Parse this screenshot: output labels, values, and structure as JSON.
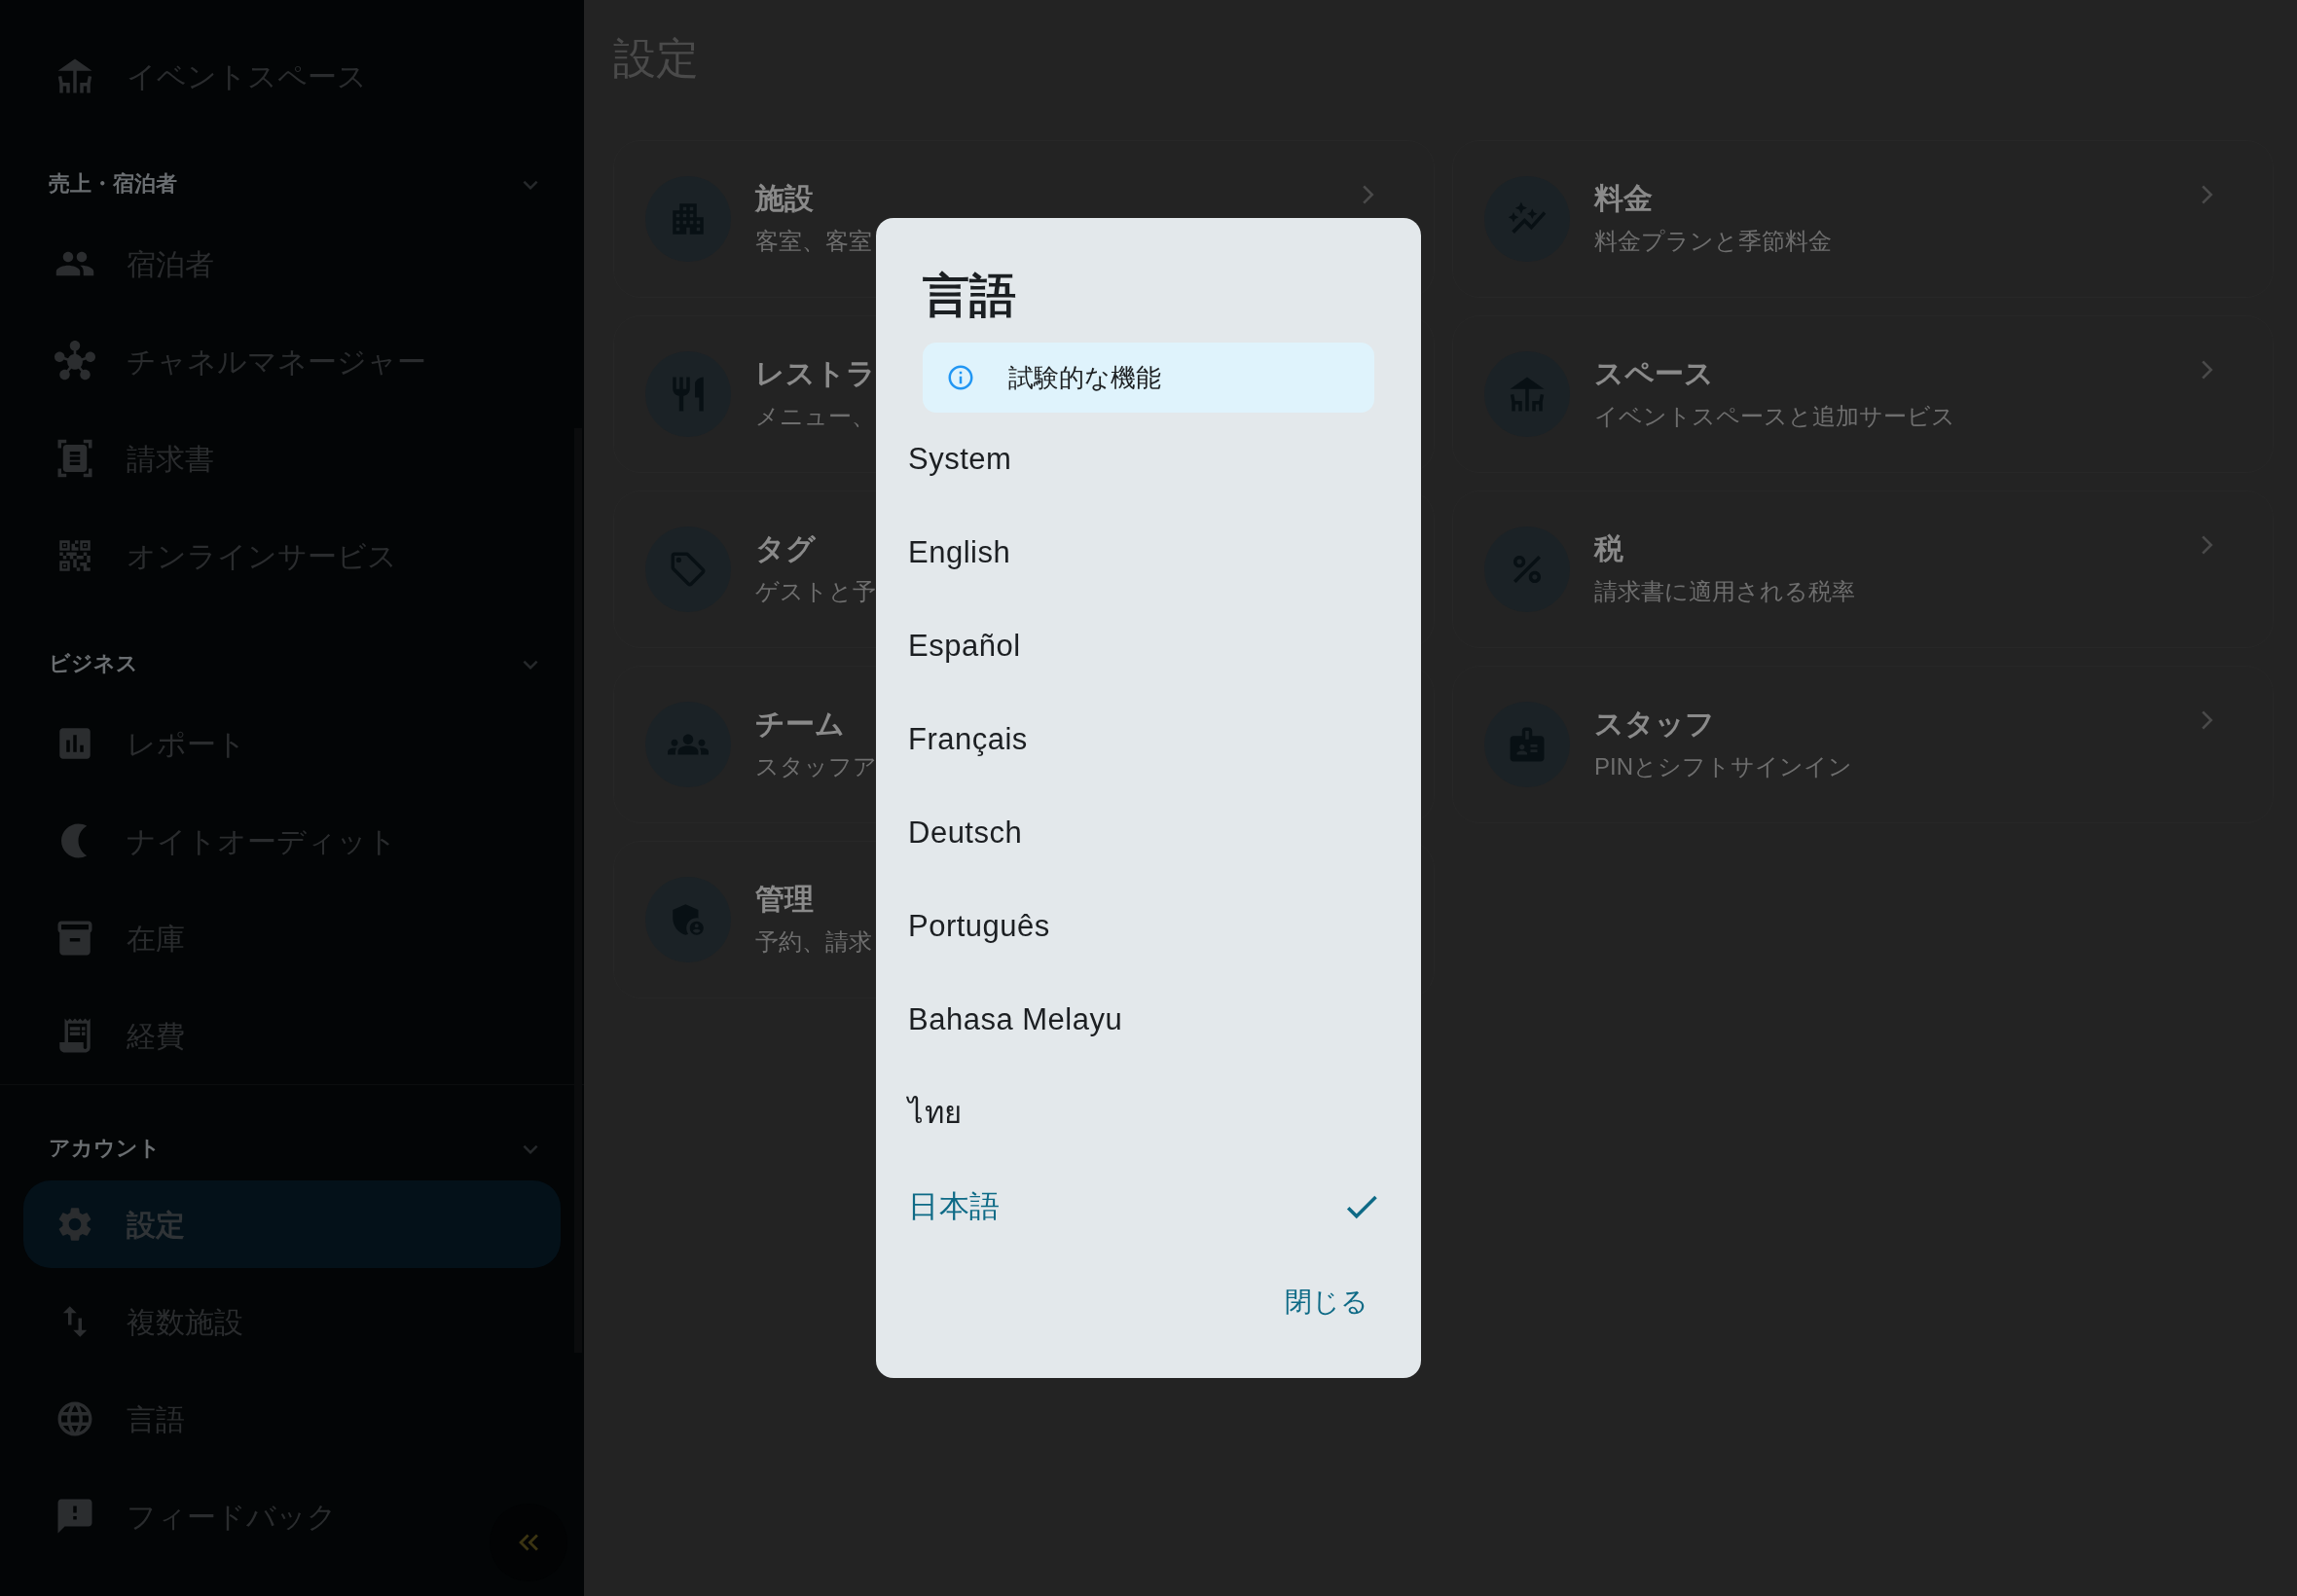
{
  "sidebar": {
    "groups": [
      {
        "items": [
          {
            "label": "イベントスペース",
            "selected": false
          }
        ]
      },
      {
        "header": "売上・宿泊者",
        "expanded": true,
        "items": [
          {
            "label": "宿泊者",
            "selected": false
          },
          {
            "label": "チャネルマネージャー",
            "selected": false
          },
          {
            "label": "請求書",
            "selected": false
          },
          {
            "label": "オンラインサービス",
            "selected": false
          }
        ]
      },
      {
        "header": "ビジネス",
        "expanded": true,
        "items": [
          {
            "label": "レポート",
            "selected": false
          },
          {
            "label": "ナイトオーディット",
            "selected": false
          },
          {
            "label": "在庫",
            "selected": false
          },
          {
            "label": "経費",
            "selected": false
          }
        ]
      },
      {
        "header": "アカウント",
        "expanded": true,
        "items": [
          {
            "label": "設定",
            "selected": true
          },
          {
            "label": "複数施設",
            "selected": false
          },
          {
            "label": "言語",
            "selected": false
          },
          {
            "label": "フィードバック",
            "selected": false
          }
        ]
      }
    ]
  },
  "page": {
    "title": "設定",
    "cards": [
      {
        "title": "施設",
        "subtitle": "客室、客室",
        "arrow": true
      },
      {
        "title": "料金",
        "subtitle": "料金プランと季節料金",
        "arrow": true
      },
      {
        "title": "レストラ",
        "subtitle": "メニュー、"
      },
      {
        "title": "スペース",
        "subtitle": "イベントスペースと追加サービス",
        "arrow": true
      },
      {
        "title": "タグ",
        "subtitle": "ゲストと予"
      },
      {
        "title": "税",
        "subtitle": "請求書に適用される税率",
        "arrow": true
      },
      {
        "title": "チーム",
        "subtitle": "スタッフア"
      },
      {
        "title": "スタッフ",
        "subtitle": "PINとシフトサインイン",
        "arrow": true
      },
      {
        "title": "管理",
        "subtitle": "予約、請求"
      }
    ]
  },
  "dialog": {
    "title": "言語",
    "notice": "試験的な機能",
    "options": [
      {
        "label": "System",
        "selected": false
      },
      {
        "label": "English",
        "selected": false
      },
      {
        "label": "Español",
        "selected": false
      },
      {
        "label": "Français",
        "selected": false
      },
      {
        "label": "Deutsch",
        "selected": false
      },
      {
        "label": "Português",
        "selected": false
      },
      {
        "label": "Bahasa Melayu",
        "selected": false
      },
      {
        "label": "ไทย",
        "selected": false
      },
      {
        "label": "日本語",
        "selected": true
      }
    ],
    "close_button": "閉じる"
  }
}
